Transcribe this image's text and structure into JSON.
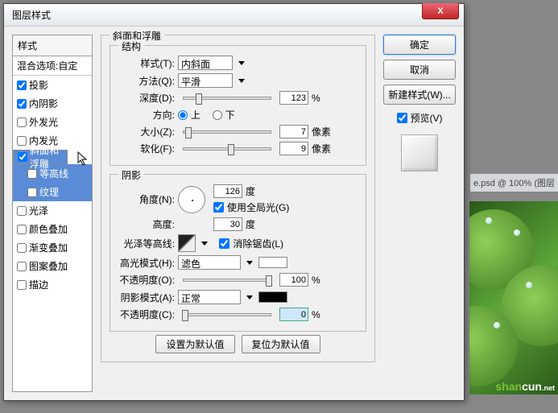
{
  "window": {
    "title": "图层样式"
  },
  "buttons": {
    "close": "X",
    "ok": "确定",
    "cancel": "取消",
    "newStyle": "新建样式(W)...",
    "preview_label": "预览(V)",
    "defaults": "设置为默认值",
    "reset": "复位为默认值"
  },
  "left": {
    "header": "样式",
    "blend": "混合选项:自定",
    "items": [
      {
        "label": "投影",
        "checked": true
      },
      {
        "label": "内阴影",
        "checked": true
      },
      {
        "label": "外发光",
        "checked": false
      },
      {
        "label": "内发光",
        "checked": false
      },
      {
        "label": "斜面和浮雕",
        "checked": true,
        "selected": true
      },
      {
        "label": "等高线",
        "checked": false,
        "sub": true
      },
      {
        "label": "纹理",
        "checked": false,
        "sub": true
      },
      {
        "label": "光泽",
        "checked": false
      },
      {
        "label": "颜色叠加",
        "checked": false
      },
      {
        "label": "渐变叠加",
        "checked": false
      },
      {
        "label": "图案叠加",
        "checked": false
      },
      {
        "label": "描边",
        "checked": false
      }
    ]
  },
  "bevel": {
    "section_title": "斜面和浮雕",
    "structure_title": "结构",
    "style_label": "样式(T):",
    "style_value": "内斜面",
    "technique_label": "方法(Q):",
    "technique_value": "平滑",
    "depth_label": "深度(D):",
    "depth_value": "123",
    "depth_unit": "%",
    "direction_label": "方向:",
    "direction_up": "上",
    "direction_down": "下",
    "size_label": "大小(Z):",
    "size_value": "7",
    "size_unit": "像素",
    "soften_label": "软化(F):",
    "soften_value": "9",
    "soften_unit": "像素"
  },
  "shading": {
    "title": "阴影",
    "angle_label": "角度(N):",
    "angle_value": "126",
    "angle_unit": "度",
    "global_label": "使用全局光(G)",
    "altitude_label": "高度:",
    "altitude_value": "30",
    "altitude_unit": "度",
    "gloss_label": "光泽等高线:",
    "antialias_label": "消除锯齿(L)",
    "highlight_mode_label": "高光模式(H):",
    "highlight_mode_value": "滤色",
    "highlight_opacity_label": "不透明度(O):",
    "highlight_opacity_value": "100",
    "highlight_opacity_unit": "%",
    "shadow_mode_label": "阴影模式(A):",
    "shadow_mode_value": "正常",
    "shadow_opacity_label": "不透明度(C):",
    "shadow_opacity_value": "0",
    "shadow_opacity_unit": "%"
  },
  "bg": {
    "caption": "e.psd @ 100% (图层",
    "watermark_a": "shan",
    "watermark_b": "cun",
    "watermark_c": ".net"
  }
}
